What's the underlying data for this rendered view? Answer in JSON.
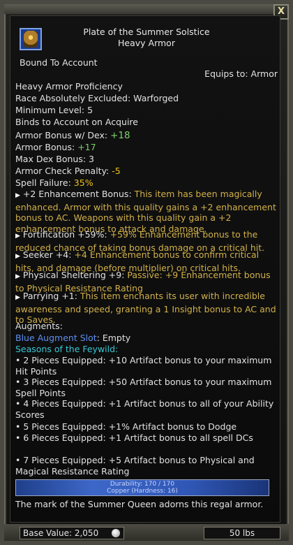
{
  "window": {
    "close_label": "X"
  },
  "item": {
    "name": "Plate of the Summer Solstice",
    "type": "Heavy Armor",
    "icon": "armor-plate-icon"
  },
  "binding": "Bound To Account",
  "equips_to": "Equips to: Armor",
  "requirements": {
    "proficiency": "Heavy Armor Proficiency",
    "race_excluded": "Race Absolutely Excluded: Warforged",
    "min_level": "Minimum Level: 5",
    "binds": "Binds to Account on Acquire"
  },
  "stats": {
    "armor_bonus_dex_label": "Armor Bonus w/ Dex: ",
    "armor_bonus_dex_value": "+18",
    "armor_bonus_label": "Armor Bonus: ",
    "armor_bonus_value": "+17",
    "max_dex": "Max Dex Bonus: 3",
    "check_penalty_label": "Armor Check Penalty: ",
    "check_penalty_value": "-5",
    "spell_failure_label": "Spell Failure: ",
    "spell_failure_value": "35%"
  },
  "effects": [
    {
      "name": "+2 Enhancement Bonus:",
      "desc": " This item has been magically enhanced. Armor with this quality gains a +2 enhancement bonus to AC. Weapons with this quality gain a +2 enhancement bonus to attack and damage."
    },
    {
      "name": "Fortification +59%:",
      "desc": " +59% Enhancement bonus to the reduced chance of taking bonus damage on a critical hit."
    },
    {
      "name": "Seeker +4:",
      "desc": " +4 Enhancement bonus to confirm critical hits, and damage (before multiplier) on critical hits."
    },
    {
      "name": "Physical Sheltering +9:",
      "desc": " Passive: +9 Enhancement bonus to Physical Resistance Rating"
    },
    {
      "name": "Parrying +1:",
      "desc": " This item enchants its user with incredible awareness and speed, granting a 1 Insight bonus to AC and to Saves."
    }
  ],
  "augments": {
    "label": "Augments:",
    "slot_name": "Blue Augment Slot",
    "slot_value": ": Empty"
  },
  "set": {
    "name": "Seasons of the Feywild:",
    "bonuses": [
      "• 2 Pieces Equipped: +10 Artifact bonus to your maximum Hit Points",
      "• 3 Pieces Equipped: +50 Artifact bonus to your maximum Spell Points",
      "• 4 Pieces Equipped: +1 Artifact bonus to all of your Ability Scores",
      "• 5 Pieces Equipped: +1% Artifact bonus to Dodge",
      "• 6 Pieces Equipped: +1 Artifact bonus to all spell DCs",
      "• 7 Pieces Equipped: +5 Artifact bonus to Physical and Magical Resistance Rating"
    ]
  },
  "durability": {
    "durability_text": "Durability: 170 / 170",
    "copper_text": "Copper (Hardness: 16)",
    "fraction": 1.0
  },
  "flavor": "The mark of the Summer Queen adorns this regal armor.",
  "footer": {
    "base_value": "Base Value: 2,050",
    "coin_icon": "silver-coin-icon",
    "weight": "50 lbs"
  }
}
